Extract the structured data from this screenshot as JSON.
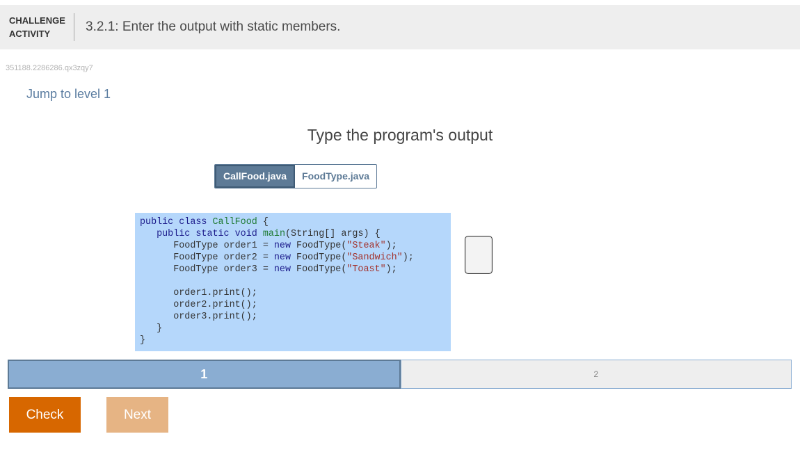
{
  "header": {
    "type_line1": "CHALLENGE",
    "type_line2": "ACTIVITY",
    "title": "3.2.1: Enter the output with static members."
  },
  "activity_id": "351188.2286286.qx3zqy7",
  "jump_link": "Jump to level 1",
  "prompt": "Type the program's output",
  "tabs": [
    {
      "label": "CallFood.java",
      "active": true
    },
    {
      "label": "FoodType.java",
      "active": false
    }
  ],
  "code": {
    "l1_public": "public",
    "l1_class": "class",
    "l1_name": "CallFood",
    "l1_brace": " {",
    "l2_public": "public",
    "l2_static": "static",
    "l2_void": "void",
    "l2_main": "main",
    "l2_rest": "(String[] args) {",
    "type": "FoodType",
    "o1": "order1",
    "o2": "order2",
    "o3": "order3",
    "eq": " = ",
    "new": "new",
    "ctor": " FoodType(",
    "s1": "\"Steak\"",
    "s2": "\"Sandwich\"",
    "s3": "\"Toast\"",
    "end": ");",
    "p1": "order1.print();",
    "p2": "order2.print();",
    "p3": "order3.print();",
    "close_inner": "}",
    "close_outer": "}"
  },
  "answer": "",
  "levels": [
    {
      "label": "1",
      "current": true
    },
    {
      "label": "2",
      "current": false
    }
  ],
  "buttons": {
    "check": "Check",
    "next": "Next"
  },
  "colors": {
    "accent_orange": "#d76700",
    "disabled_orange": "#e6b484",
    "tab_blue": "#5d7a96",
    "code_bg": "#b5d7fb",
    "level_current": "#8aadd2"
  }
}
